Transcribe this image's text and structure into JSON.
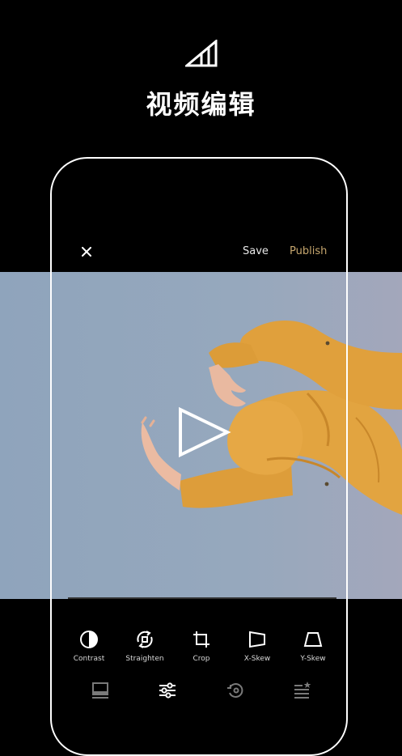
{
  "headline": "视频编辑",
  "toolbar": {
    "save_label": "Save",
    "publish_label": "Publish"
  },
  "colors": {
    "accent": "#c6a66e",
    "background": "#000000",
    "sky": "#96a8bd",
    "jacket": "#e1a23c"
  },
  "tools": [
    {
      "label": "Contrast",
      "icon": "contrast-icon"
    },
    {
      "label": "Straighten",
      "icon": "straighten-icon"
    },
    {
      "label": "Crop",
      "icon": "crop-icon"
    },
    {
      "label": "X-Skew",
      "icon": "x-skew-icon"
    },
    {
      "label": "Y-Skew",
      "icon": "y-skew-icon"
    }
  ],
  "tabs": [
    {
      "icon": "presets-icon",
      "active": false
    },
    {
      "icon": "adjust-sliders-icon",
      "active": true
    },
    {
      "icon": "history-icon",
      "active": false
    },
    {
      "icon": "recipes-icon",
      "active": false
    }
  ]
}
